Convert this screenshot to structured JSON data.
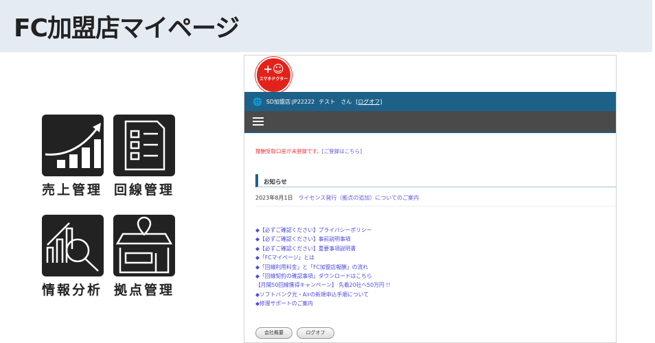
{
  "page_title": "FC加盟店マイページ",
  "tiles": [
    {
      "label": "売上管理",
      "icon": "sales-growth-icon"
    },
    {
      "label": "回線管理",
      "icon": "checklist-icon"
    },
    {
      "label": "情報分析",
      "icon": "analysis-icon"
    },
    {
      "label": "拠点管理",
      "icon": "store-location-icon"
    }
  ],
  "portal": {
    "logo_text": "スマホドクター",
    "user_bar": {
      "store": "SD加盟店:JP22222",
      "name": "テスト　さん",
      "logoff": "[ログオフ]"
    },
    "warning": "報酬受取口座が未登録です。",
    "warning_link": "[ご登録はこちら]",
    "news_heading": "お知らせ",
    "news": [
      {
        "date": "2023年8月1日",
        "title": "ライセンス発行（拠点の追加）についてのご案内"
      }
    ],
    "links": [
      "◆【必ずご確認ください】プライバシーポリシー",
      "◆【必ずご確認ください】事前説明事項",
      "◆【必ずご確認ください】重要事項説明書",
      "◆「FCマイページ」とは",
      "◆「回線利用料金」と「FC加盟店報酬」の流れ",
      "◆「回線契約の確認事項」ダウンロードはこちら",
      "【月間50回線獲得キャンペーン】 先着20社へ50万円 !!",
      "◆ソフトバンク光・Airの新規申込手順について",
      "◆修理サポートのご案内"
    ],
    "buttons": {
      "company": "会社概要",
      "logoff": "ログオフ"
    }
  }
}
